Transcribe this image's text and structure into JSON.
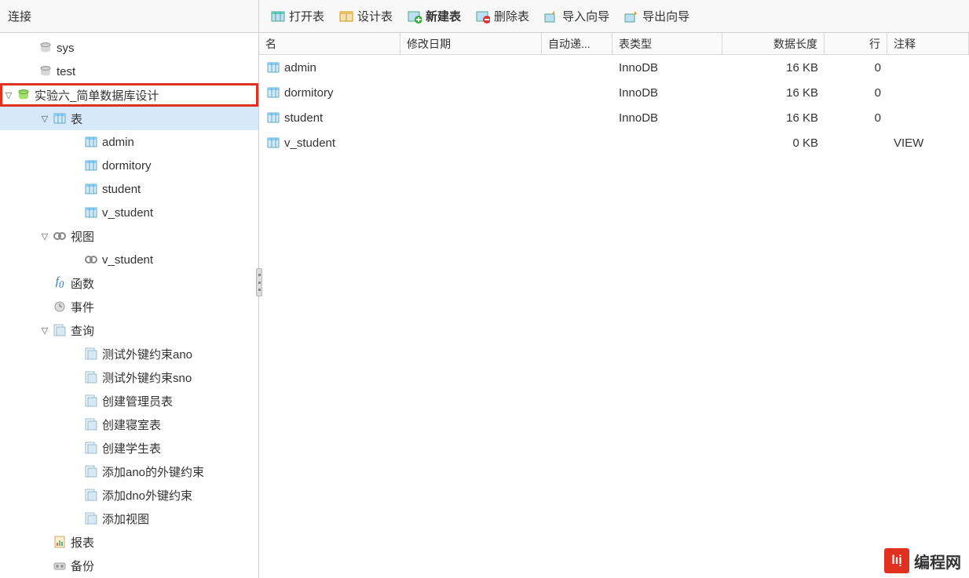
{
  "topbar": {
    "left_label": "连接",
    "buttons": [
      {
        "label": "打开表",
        "icon": "table-open"
      },
      {
        "label": "设计表",
        "icon": "table-design"
      },
      {
        "label": "新建表",
        "icon": "table-new",
        "bold": true
      },
      {
        "label": "删除表",
        "icon": "table-delete"
      },
      {
        "label": "导入向导",
        "icon": "import-wizard"
      },
      {
        "label": "导出向导",
        "icon": "export-wizard"
      }
    ]
  },
  "tree": [
    {
      "level": 0,
      "exp": "",
      "icon": "db-grey",
      "label": "sys"
    },
    {
      "level": 0,
      "exp": "",
      "icon": "db-grey",
      "label": "test"
    },
    {
      "level": 1,
      "exp": "down",
      "icon": "db-green",
      "label": "实验六_简单数据库设计",
      "highlighted": true
    },
    {
      "level": 2,
      "exp": "down",
      "icon": "tablegrp",
      "label": "表",
      "selected": true
    },
    {
      "level": 3,
      "exp": "",
      "icon": "table",
      "label": "admin"
    },
    {
      "level": 3,
      "exp": "",
      "icon": "table",
      "label": "dormitory"
    },
    {
      "level": 3,
      "exp": "",
      "icon": "table",
      "label": "student"
    },
    {
      "level": 3,
      "exp": "",
      "icon": "table",
      "label": "v_student"
    },
    {
      "level": 2,
      "exp": "down",
      "icon": "view-grp",
      "label": "视图"
    },
    {
      "level": 3,
      "exp": "",
      "icon": "view",
      "label": "v_student"
    },
    {
      "level": 2,
      "exp": "",
      "icon": "fx",
      "label": "函数"
    },
    {
      "level": 2,
      "exp": "",
      "icon": "event",
      "label": "事件"
    },
    {
      "level": 2,
      "exp": "down",
      "icon": "query-grp",
      "label": "查询"
    },
    {
      "level": 3,
      "exp": "",
      "icon": "query",
      "label": "测试外键约束ano"
    },
    {
      "level": 3,
      "exp": "",
      "icon": "query",
      "label": "测试外键约束sno"
    },
    {
      "level": 3,
      "exp": "",
      "icon": "query",
      "label": "创建管理员表"
    },
    {
      "level": 3,
      "exp": "",
      "icon": "query",
      "label": "创建寝室表"
    },
    {
      "level": 3,
      "exp": "",
      "icon": "query",
      "label": "创建学生表"
    },
    {
      "level": 3,
      "exp": "",
      "icon": "query",
      "label": "添加ano的外键约束"
    },
    {
      "level": 3,
      "exp": "",
      "icon": "query",
      "label": "添加dno外键约束"
    },
    {
      "level": 3,
      "exp": "",
      "icon": "query",
      "label": "添加视图"
    },
    {
      "level": 2,
      "exp": "",
      "icon": "report",
      "label": "报表"
    },
    {
      "level": 2,
      "exp": "",
      "icon": "backup",
      "label": "备份"
    }
  ],
  "columns": [
    "名",
    "修改日期",
    "自动递...",
    "表类型",
    "数据长度",
    "行",
    "注释"
  ],
  "rows": [
    {
      "name": "admin",
      "mod": "",
      "auto": "",
      "type": "InnoDB",
      "len": "16 KB",
      "rows": "0",
      "comment": ""
    },
    {
      "name": "dormitory",
      "mod": "",
      "auto": "",
      "type": "InnoDB",
      "len": "16 KB",
      "rows": "0",
      "comment": ""
    },
    {
      "name": "student",
      "mod": "",
      "auto": "",
      "type": "InnoDB",
      "len": "16 KB",
      "rows": "0",
      "comment": ""
    },
    {
      "name": "v_student",
      "mod": "",
      "auto": "",
      "type": "",
      "len": "0 KB",
      "rows": "",
      "comment": "VIEW"
    }
  ],
  "watermark": {
    "badge": "lıị",
    "text": "编程网"
  }
}
